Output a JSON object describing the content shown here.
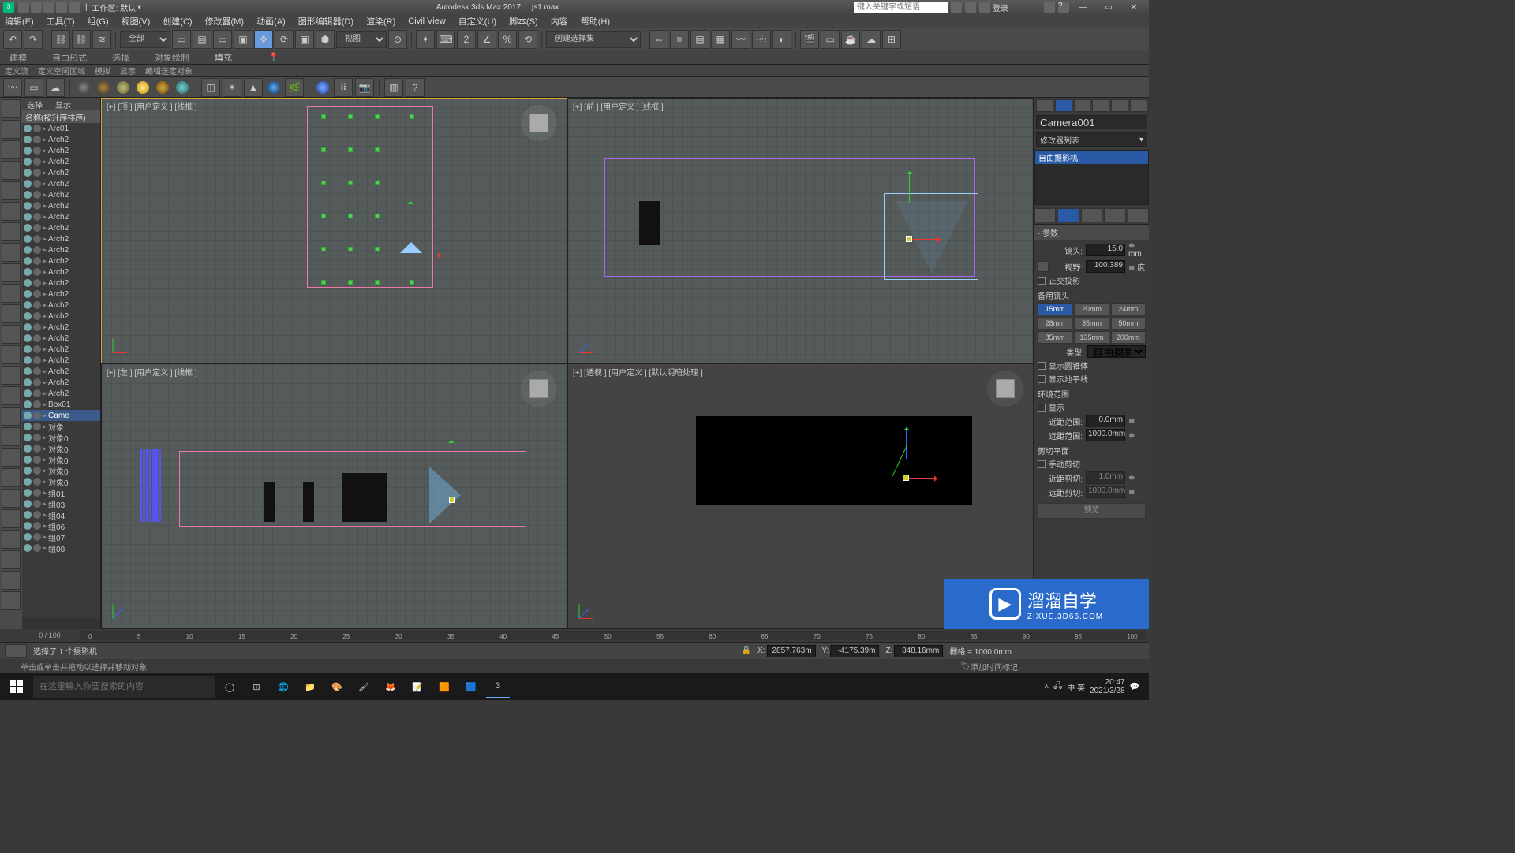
{
  "title": {
    "app": "Autodesk 3ds Max 2017",
    "file": "js1.max",
    "workspace_label": "工作区: 默认"
  },
  "search_placeholder": "键入关键字或短语",
  "login_label": "登录",
  "menus": [
    "编辑(E)",
    "工具(T)",
    "组(G)",
    "视图(V)",
    "创建(C)",
    "修改器(M)",
    "动画(A)",
    "图形编辑器(D)",
    "渲染(R)",
    "Civil View",
    "自定义(U)",
    "脚本(S)",
    "内容",
    "帮助(H)"
  ],
  "toolbar1": {
    "filter": "全部",
    "ref": "视图",
    "snap": "创建选择集"
  },
  "ribbon_tabs": [
    "建模",
    "自由形式",
    "选择",
    "对象绘制",
    "填充"
  ],
  "subribbon": [
    "定义流",
    "定义空闲区域",
    "模拟",
    "显示",
    "编辑选定对象"
  ],
  "scene": {
    "header": [
      "选择",
      "显示"
    ],
    "list_header": "名称(按升序排序)",
    "items": [
      "Arc01",
      "Arch2",
      "Arch2",
      "Arch2",
      "Arch2",
      "Arch2",
      "Arch2",
      "Arch2",
      "Arch2",
      "Arch2",
      "Arch2",
      "Arch2",
      "Arch2",
      "Arch2",
      "Arch2",
      "Arch2",
      "Arch2",
      "Arch2",
      "Arch2",
      "Arch2",
      "Arch2",
      "Arch2",
      "Arch2",
      "Arch2",
      "Arch2",
      "Box01",
      "Came",
      "对象",
      "对象0",
      "对象0",
      "对象0",
      "对象0",
      "对象0",
      "组01",
      "组03",
      "组04",
      "组06",
      "组07",
      "组08"
    ],
    "selected_index": 26
  },
  "viewports": {
    "top": "[+] [顶 ] [用户定义 ] [线框 ]",
    "front": "[+] [前 ] [用户定义 ] [线框 ]",
    "left": "[+] [左 ] [用户定义 ] [线框 ]",
    "persp": "[+] [透视 ] [用户定义 ] [默认明暗处理 ]"
  },
  "right": {
    "object_name": "Camera001",
    "modlist_label": "修改器列表",
    "stack_item": "自由摄影机",
    "rollout_params": "参数",
    "lens_label": "镜头:",
    "lens_val": "15.0",
    "lens_unit": "≑ mm",
    "fov_label": "视野:",
    "fov_val": "100.389",
    "fov_unit": "≑ 度",
    "ortho": "正交投影",
    "stock_label": "备用镜头",
    "lenses": [
      "15mm",
      "20mm",
      "24mm",
      "28mm",
      "35mm",
      "50mm",
      "85mm",
      "135mm",
      "200mm"
    ],
    "active_lens": 0,
    "type_label": "类型:",
    "type_val": "自由摄影机",
    "show_cone": "显示圆锥体",
    "show_horizon": "显示地平线",
    "env_label": "环境范围",
    "env_show": "显示",
    "near_label": "近距范围:",
    "near_val": "0.0mm",
    "far_label": "远距范围:",
    "far_val": "1000.0mm",
    "clip_label": "剪切平面",
    "clip_manual": "手动剪切",
    "clip_near_l": "近距剪切:",
    "clip_near_v": "1.0mm",
    "clip_far_l": "远距剪切:",
    "clip_far_v": "1000.0mm",
    "preview_btn": "预览"
  },
  "timeline": {
    "frame": "0 / 100",
    "ticks": [
      "0",
      "5",
      "10",
      "15",
      "20",
      "25",
      "30",
      "35",
      "40",
      "45",
      "50",
      "55",
      "60",
      "65",
      "70",
      "75",
      "80",
      "85",
      "90",
      "95",
      "100"
    ]
  },
  "status": {
    "sel_msg": "选择了 1 个摄影机",
    "hint": "单击或单击并拖动以选择并移动对象",
    "x": "2857.763m",
    "y": "-4175.39m",
    "z": "848.16mm",
    "grid": "栅格 = 1000.0mm",
    "addkey": "添加时间标记"
  },
  "watermark": {
    "brand": "溜溜自学",
    "url": "ZIXUE.3D66.COM"
  },
  "taskbar": {
    "placeholder": "在这里输入你要搜索的内容",
    "time": "20:47",
    "date": "2021/3/28",
    "ime": "中 英"
  }
}
